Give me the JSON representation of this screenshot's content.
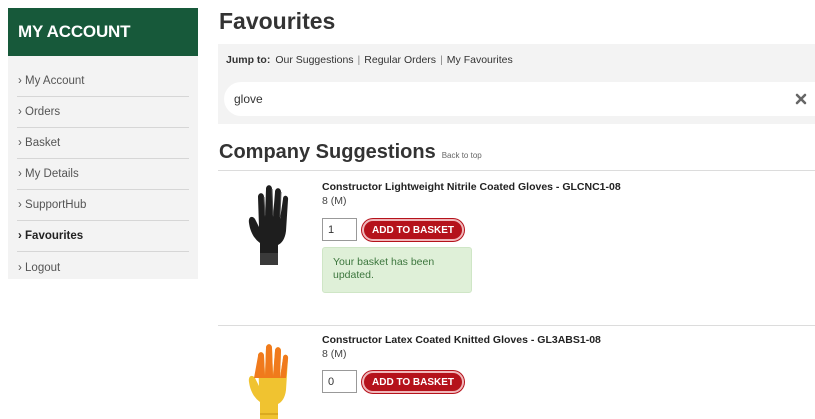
{
  "sidebar": {
    "title": "MY ACCOUNT",
    "items": [
      {
        "label": "› My Account"
      },
      {
        "label": "› Orders"
      },
      {
        "label": "› Basket"
      },
      {
        "label": "› My Details"
      },
      {
        "label": "› SupportHub"
      },
      {
        "label": "› Favourites",
        "active": true
      },
      {
        "label": "› Logout"
      }
    ]
  },
  "main": {
    "title": "Favourites",
    "jump_to": {
      "label": "Jump to:",
      "links": [
        "Our Suggestions",
        "Regular Orders",
        "My Favourites"
      ]
    },
    "search": {
      "value": "glove"
    },
    "section": {
      "title": "Company Suggestions",
      "back_to_top": "Back to top"
    },
    "products": [
      {
        "name": "Constructor Lightweight Nitrile Coated Gloves - GLCNC1-08",
        "size": "8 (M)",
        "quantity": "1",
        "add_label": "ADD TO BASKET",
        "message": "Your basket has been updated."
      },
      {
        "name": "Constructor Latex Coated Knitted Gloves - GL3ABS1-08",
        "size": "8 (M)",
        "quantity": "0",
        "add_label": "ADD TO BASKET"
      }
    ]
  },
  "colors": {
    "brand_green": "#17593a",
    "button_red": "#b5121b",
    "success_bg": "#dff0d8",
    "success_text": "#3c763d"
  }
}
